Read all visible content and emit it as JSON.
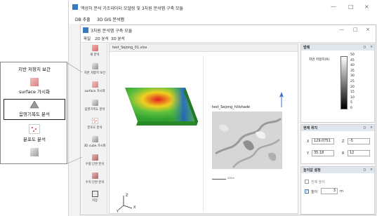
{
  "outer_window": {
    "title": "맥상하 분석 가조데이터 모델링 및 3차원 분석맵 구축 모듈",
    "menu": [
      "DB 추출",
      "3D GIS 분석맵"
    ],
    "controls": [
      "—",
      "□",
      "×"
    ]
  },
  "inner_window": {
    "title": "3차원 분석맵 구축 모듈",
    "menu": [
      "파일",
      "2D 분석",
      "3D 분석"
    ],
    "controls": [
      "—",
      "□",
      "×"
    ]
  },
  "toolbar": [
    {
      "label": "새 분석",
      "icon": "new-analysis-icon"
    },
    {
      "label": "지반 저항치 보간",
      "icon": "ground-interpolation-icon"
    },
    {
      "label": "surface 가시화",
      "icon": "surface-visualization-icon"
    },
    {
      "label": "음영기복도 분석",
      "icon": "hillshade-icon"
    },
    {
      "label": "분포도 분석",
      "icon": "distribution-icon"
    },
    {
      "label": "3D cube 가시화",
      "icon": "cube-visualization-icon"
    },
    {
      "label": "수평 단면 분석",
      "icon": "horizontal-section-icon"
    },
    {
      "label": "수직 단면 분석",
      "icon": "vertical-section-icon"
    },
    {
      "label": "저장",
      "icon": "save-icon"
    }
  ],
  "view": {
    "tab": "test_Sejong_01.xlsx",
    "hillshade_title": "test_Sejong_hillshade",
    "scale_label": "50km",
    "axes": {
      "x": "X",
      "y": "Y",
      "z": "Z"
    }
  },
  "legend": {
    "header": "범례",
    "label": "지반 저항치(R)",
    "ticks": [
      "50",
      "45",
      "40",
      "35",
      "30",
      "25",
      "20",
      "15",
      "10",
      "5",
      "0"
    ]
  },
  "position": {
    "header": "현재 위치",
    "x_label": "X",
    "x_value": "129.0751",
    "z_label": "Z",
    "z_value": "-5",
    "y_label": "Y",
    "y_value": "35.18",
    "r_label": "R",
    "r_value": "12"
  },
  "height_setting": {
    "header": "높이값 설정",
    "all_height_label": "전체 높이",
    "height_label": "높이",
    "height_value": "3",
    "unit": "m"
  },
  "zoom_callout": {
    "items": [
      "지반 저항치 보간",
      "surface 가시화",
      "음영기복도 분석",
      "분포도 분석"
    ]
  },
  "colors": {
    "panel_header": "#dfe6ee",
    "accent": "#3a78c2"
  }
}
